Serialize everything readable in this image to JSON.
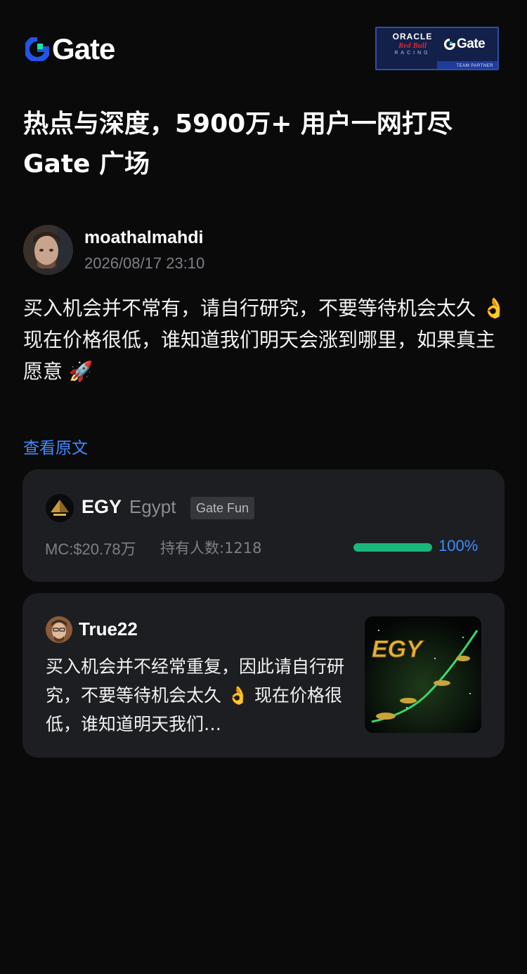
{
  "header": {
    "logo_text": "Gate",
    "partner_badge": {
      "line1": "ORACLE",
      "line2": "Red Bull",
      "line3": "RACING",
      "brand": "Gate",
      "caption": "TEAM PARTNER"
    }
  },
  "headline": {
    "line1": "热点与深度，5900万+ 用户一网打尽",
    "line2": "Gate 广场"
  },
  "author": {
    "name": "moathalmahdi",
    "timestamp": "2026/08/17 23:10"
  },
  "post": {
    "paragraph1": "买入机会并不常有，请自行研究，不要等待机会太久 👌",
    "paragraph2": "现在价格很低，谁知道我们明天会涨到哪里，如果真主愿意 🚀",
    "view_original": "查看原文"
  },
  "token": {
    "symbol": "EGY",
    "name": "Egypt",
    "tag": "Gate Fun",
    "market_cap": "MC:$20.78万",
    "holders": "持有人数:1218",
    "progress_percent": 100,
    "progress_label": "100%"
  },
  "quote": {
    "author": "True22",
    "text": "买入机会并不经常重复，因此请自行研究，不要等待机会太久 👌 现在价格很低，谁知道明天我们…",
    "image_caption": "EGY"
  },
  "colors": {
    "background": "#0a0a0b",
    "card": "#1d1e21",
    "accent_blue": "#3f8bff",
    "progress_green": "#19b77a",
    "muted_text": "#7d7f86"
  }
}
